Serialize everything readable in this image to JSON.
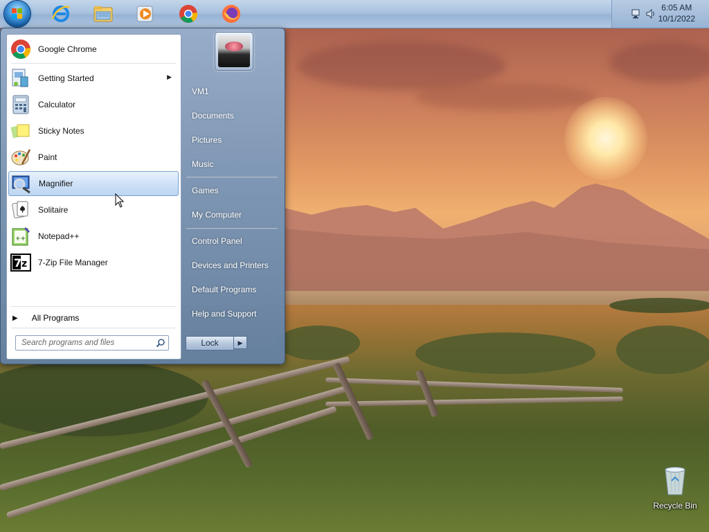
{
  "taskbar": {
    "start_icon": "windows-orb-icon",
    "pinned": [
      {
        "name": "internet-explorer-icon"
      },
      {
        "name": "file-explorer-icon"
      },
      {
        "name": "media-player-icon"
      },
      {
        "name": "chrome-icon"
      },
      {
        "name": "firefox-icon"
      }
    ],
    "tray": {
      "icons": [
        "network-icon",
        "volume-icon"
      ],
      "time": "6:05 AM",
      "date": "10/1/2022"
    }
  },
  "start_menu": {
    "programs": [
      {
        "label": "Google Chrome",
        "icon": "chrome-icon"
      },
      {
        "label": "Getting Started",
        "icon": "getting-started-icon",
        "has_submenu": true
      },
      {
        "label": "Calculator",
        "icon": "calculator-icon"
      },
      {
        "label": "Sticky Notes",
        "icon": "sticky-notes-icon"
      },
      {
        "label": "Paint",
        "icon": "paint-icon"
      },
      {
        "label": "Magnifier",
        "icon": "magnifier-icon",
        "highlighted": true
      },
      {
        "label": "Solitaire",
        "icon": "solitaire-icon"
      },
      {
        "label": "Notepad++",
        "icon": "notepad-plus-plus-icon"
      },
      {
        "label": "7-Zip File Manager",
        "icon": "seven-zip-icon"
      }
    ],
    "all_programs": "All Programs",
    "search_placeholder": "Search programs and files",
    "right_links": [
      {
        "label": "VM1"
      },
      {
        "label": "Documents"
      },
      {
        "label": "Pictures"
      },
      {
        "label": "Music"
      },
      {
        "label": "Games"
      },
      {
        "label": "My Computer"
      },
      {
        "label": "Control Panel"
      },
      {
        "label": "Devices and Printers"
      },
      {
        "label": "Default Programs"
      },
      {
        "label": "Help and Support"
      }
    ],
    "lock_button": "Lock"
  },
  "desktop": {
    "icons": [
      {
        "label": "Recycle Bin",
        "icon": "recycle-bin-icon"
      }
    ]
  },
  "colors": {
    "taskbar": "#a9c2de",
    "menu_highlight": "#cfe2f7",
    "menu_frame": "#7894b4"
  }
}
